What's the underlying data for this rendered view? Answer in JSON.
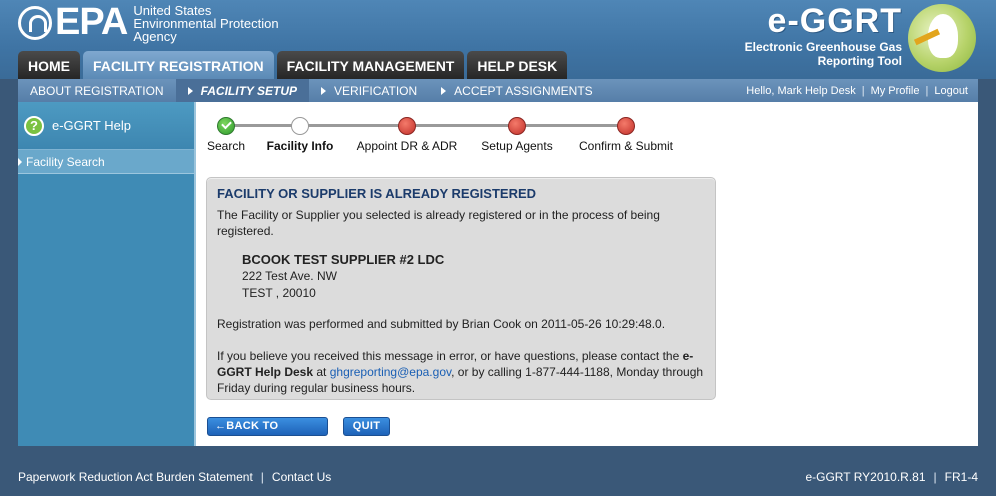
{
  "header": {
    "epa_word": "EPA",
    "agency_lines": [
      "United States",
      "Environmental Protection",
      "Agency"
    ],
    "brand_title": "e-GGRT",
    "brand_subtitle_lines": [
      "Electronic Greenhouse Gas",
      "Reporting Tool"
    ]
  },
  "main_tabs": [
    {
      "label": "HOME",
      "active": false
    },
    {
      "label": "FACILITY REGISTRATION",
      "active": true
    },
    {
      "label": "FACILITY MANAGEMENT",
      "active": false
    },
    {
      "label": "HELP DESK",
      "active": false
    }
  ],
  "subnav": {
    "items": [
      {
        "label": "ABOUT REGISTRATION",
        "active": false
      },
      {
        "label": "FACILITY SETUP",
        "active": true
      },
      {
        "label": "VERIFICATION",
        "active": false
      },
      {
        "label": "ACCEPT ASSIGNMENTS",
        "active": false
      }
    ],
    "greeting": "Hello, Mark Help Desk",
    "profile": "My Profile",
    "logout": "Logout",
    "separator": "|"
  },
  "sidebar": {
    "help_label": "e-GGRT Help",
    "help_icon_glyph": "?",
    "items": [
      {
        "label": "Facility Search"
      }
    ]
  },
  "steps": [
    {
      "label": "Search",
      "status": "done"
    },
    {
      "label": "Facility Info",
      "status": "current"
    },
    {
      "label": "Appoint DR & ADR",
      "status": "todo"
    },
    {
      "label": "Setup Agents",
      "status": "todo"
    },
    {
      "label": "Confirm & Submit",
      "status": "todo"
    }
  ],
  "message": {
    "title": "FACILITY OR SUPPLIER IS ALREADY REGISTERED",
    "intro": "The Facility or Supplier you selected is already registered or in the process of being registered.",
    "address": {
      "name": "BCOOK TEST SUPPLIER #2 LDC",
      "line1": "222 Test Ave. NW",
      "line2": "TEST , 20010"
    },
    "registration": "Registration was performed and submitted by Brian Cook on 2011-05-26 10:29:48.0.",
    "contact_pre": "If you believe you received this message in error, or have questions, please contact the ",
    "contact_helpdesk": "e-GGRT Help Desk",
    "contact_at": " at ",
    "contact_email": "ghgreporting@epa.gov",
    "contact_post": ", or by calling 1-877-444-1188, Monday through Friday during regular business hours."
  },
  "buttons": {
    "back": "←BACK TO SEARCH",
    "quit": "QUIT"
  },
  "footer": {
    "paperwork": "Paperwork Reduction Act Burden Statement",
    "contact": "Contact Us",
    "version": "e-GGRT RY2010.R.81",
    "screen_id": "FR1-4",
    "separator": "|"
  }
}
